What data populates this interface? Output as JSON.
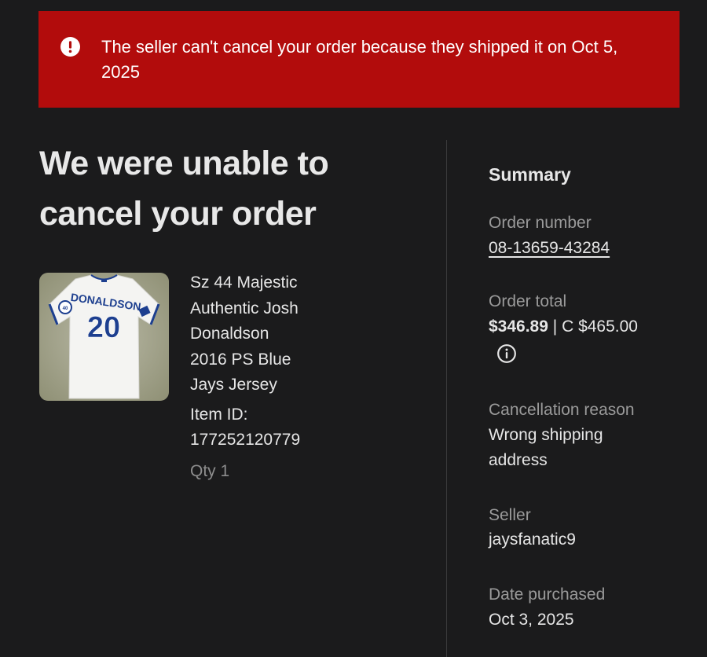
{
  "alert": {
    "icon": "exclamation-circle-icon",
    "message": "The seller can't cancel your order because they shipped it on Oct 5, 2025"
  },
  "heading": "We were unable to cancel your order",
  "item": {
    "image_icon": "jersey-thumbnail",
    "jersey_name": "DONALDSON",
    "jersey_number": "20",
    "title": "Sz 44 Majestic Authentic Josh Donaldson 2016 PS Blue Jays Jersey",
    "id_text": "Item ID: 177252120779",
    "qty_text": "Qty 1"
  },
  "summary": {
    "title": "Summary",
    "order_number_label": "Order number",
    "order_number": "08-13659-43284",
    "order_total_label": "Order total",
    "order_total_usd": "$346.89",
    "separator": "|",
    "order_total_cad": "C $465.00",
    "info_icon": "info-circle-icon",
    "cancellation_reason_label": "Cancellation reason",
    "cancellation_reason": "Wrong shipping address",
    "seller_label": "Seller",
    "seller": "jaysfanatic9",
    "date_purchased_label": "Date purchased",
    "date_purchased": "Oct 3, 2025"
  },
  "colors": {
    "background": "#1b1b1c",
    "alert_bg": "#b20c0c",
    "text": "#e6e6e6",
    "muted": "#9a9a9a"
  }
}
